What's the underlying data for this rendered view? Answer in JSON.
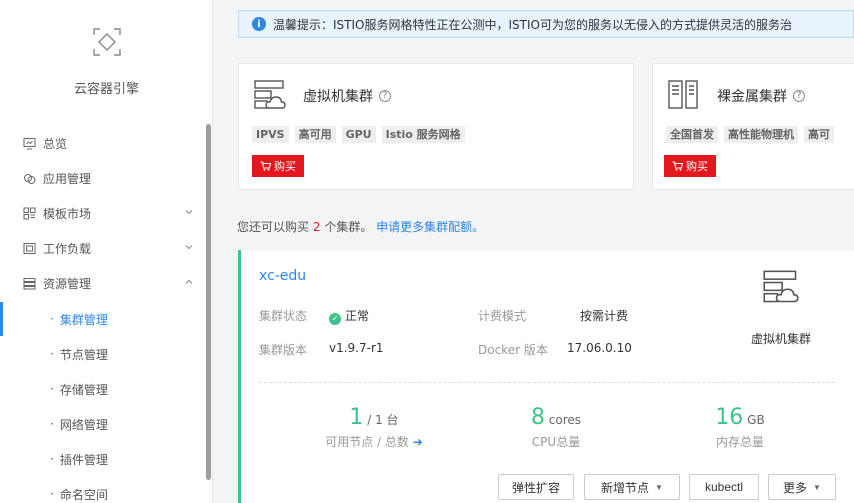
{
  "sidebar": {
    "brand": "云容器引擎",
    "items": [
      {
        "label": "总览",
        "icon": "dashboard-icon"
      },
      {
        "label": "应用管理",
        "icon": "app-icon"
      },
      {
        "label": "模板市场",
        "icon": "template-icon",
        "expand": "down"
      },
      {
        "label": "工作负载",
        "icon": "workload-icon",
        "expand": "down"
      },
      {
        "label": "资源管理",
        "icon": "resource-icon",
        "expand": "up"
      }
    ],
    "subitems": [
      {
        "label": "集群管理",
        "active": true
      },
      {
        "label": "节点管理"
      },
      {
        "label": "存储管理"
      },
      {
        "label": "网络管理"
      },
      {
        "label": "插件管理"
      },
      {
        "label": "命名空间"
      }
    ]
  },
  "notice": {
    "text": "温馨提示：ISTIO服务网格特性正在公测中，ISTIO可为您的服务以无侵入的方式提供灵活的服务治"
  },
  "cards": [
    {
      "title": "虚拟机集群",
      "tags": [
        "IPVS",
        "高可用",
        "GPU",
        "Istio 服务网格"
      ],
      "buy": "购买"
    },
    {
      "title": "裸金属集群",
      "tags": [
        "全国首发",
        "高性能物理机",
        "高可"
      ],
      "buy": "购买"
    }
  ],
  "quota": {
    "prefix": "您还可以购买",
    "num": "2",
    "suffix": "个集群。",
    "link": "申请更多集群配额。"
  },
  "cluster": {
    "name": "xc-edu",
    "status_label": "集群状态",
    "status_value": "正常",
    "billing_label": "计费模式",
    "billing_value": "按需计费",
    "version_label": "集群版本",
    "version_value": "v1.9.7-r1",
    "docker_label": "Docker 版本",
    "docker_value": "17.06.0.10",
    "type_label": "虚拟机集群",
    "stats": [
      {
        "big": "1",
        "unit": "/ 1 台",
        "label": "可用节点 / 总数"
      },
      {
        "big": "8",
        "unit": "cores",
        "label": "CPU总量"
      },
      {
        "big": "16",
        "unit": "GB",
        "label": "内存总量"
      }
    ],
    "actions": {
      "scale": "弹性扩容",
      "add_node": "新增节点",
      "kubectl": "kubectl",
      "more": "更多"
    }
  },
  "colors": {
    "accent": "#2f86e6",
    "success": "#3dc48a",
    "danger": "#e4171e"
  }
}
